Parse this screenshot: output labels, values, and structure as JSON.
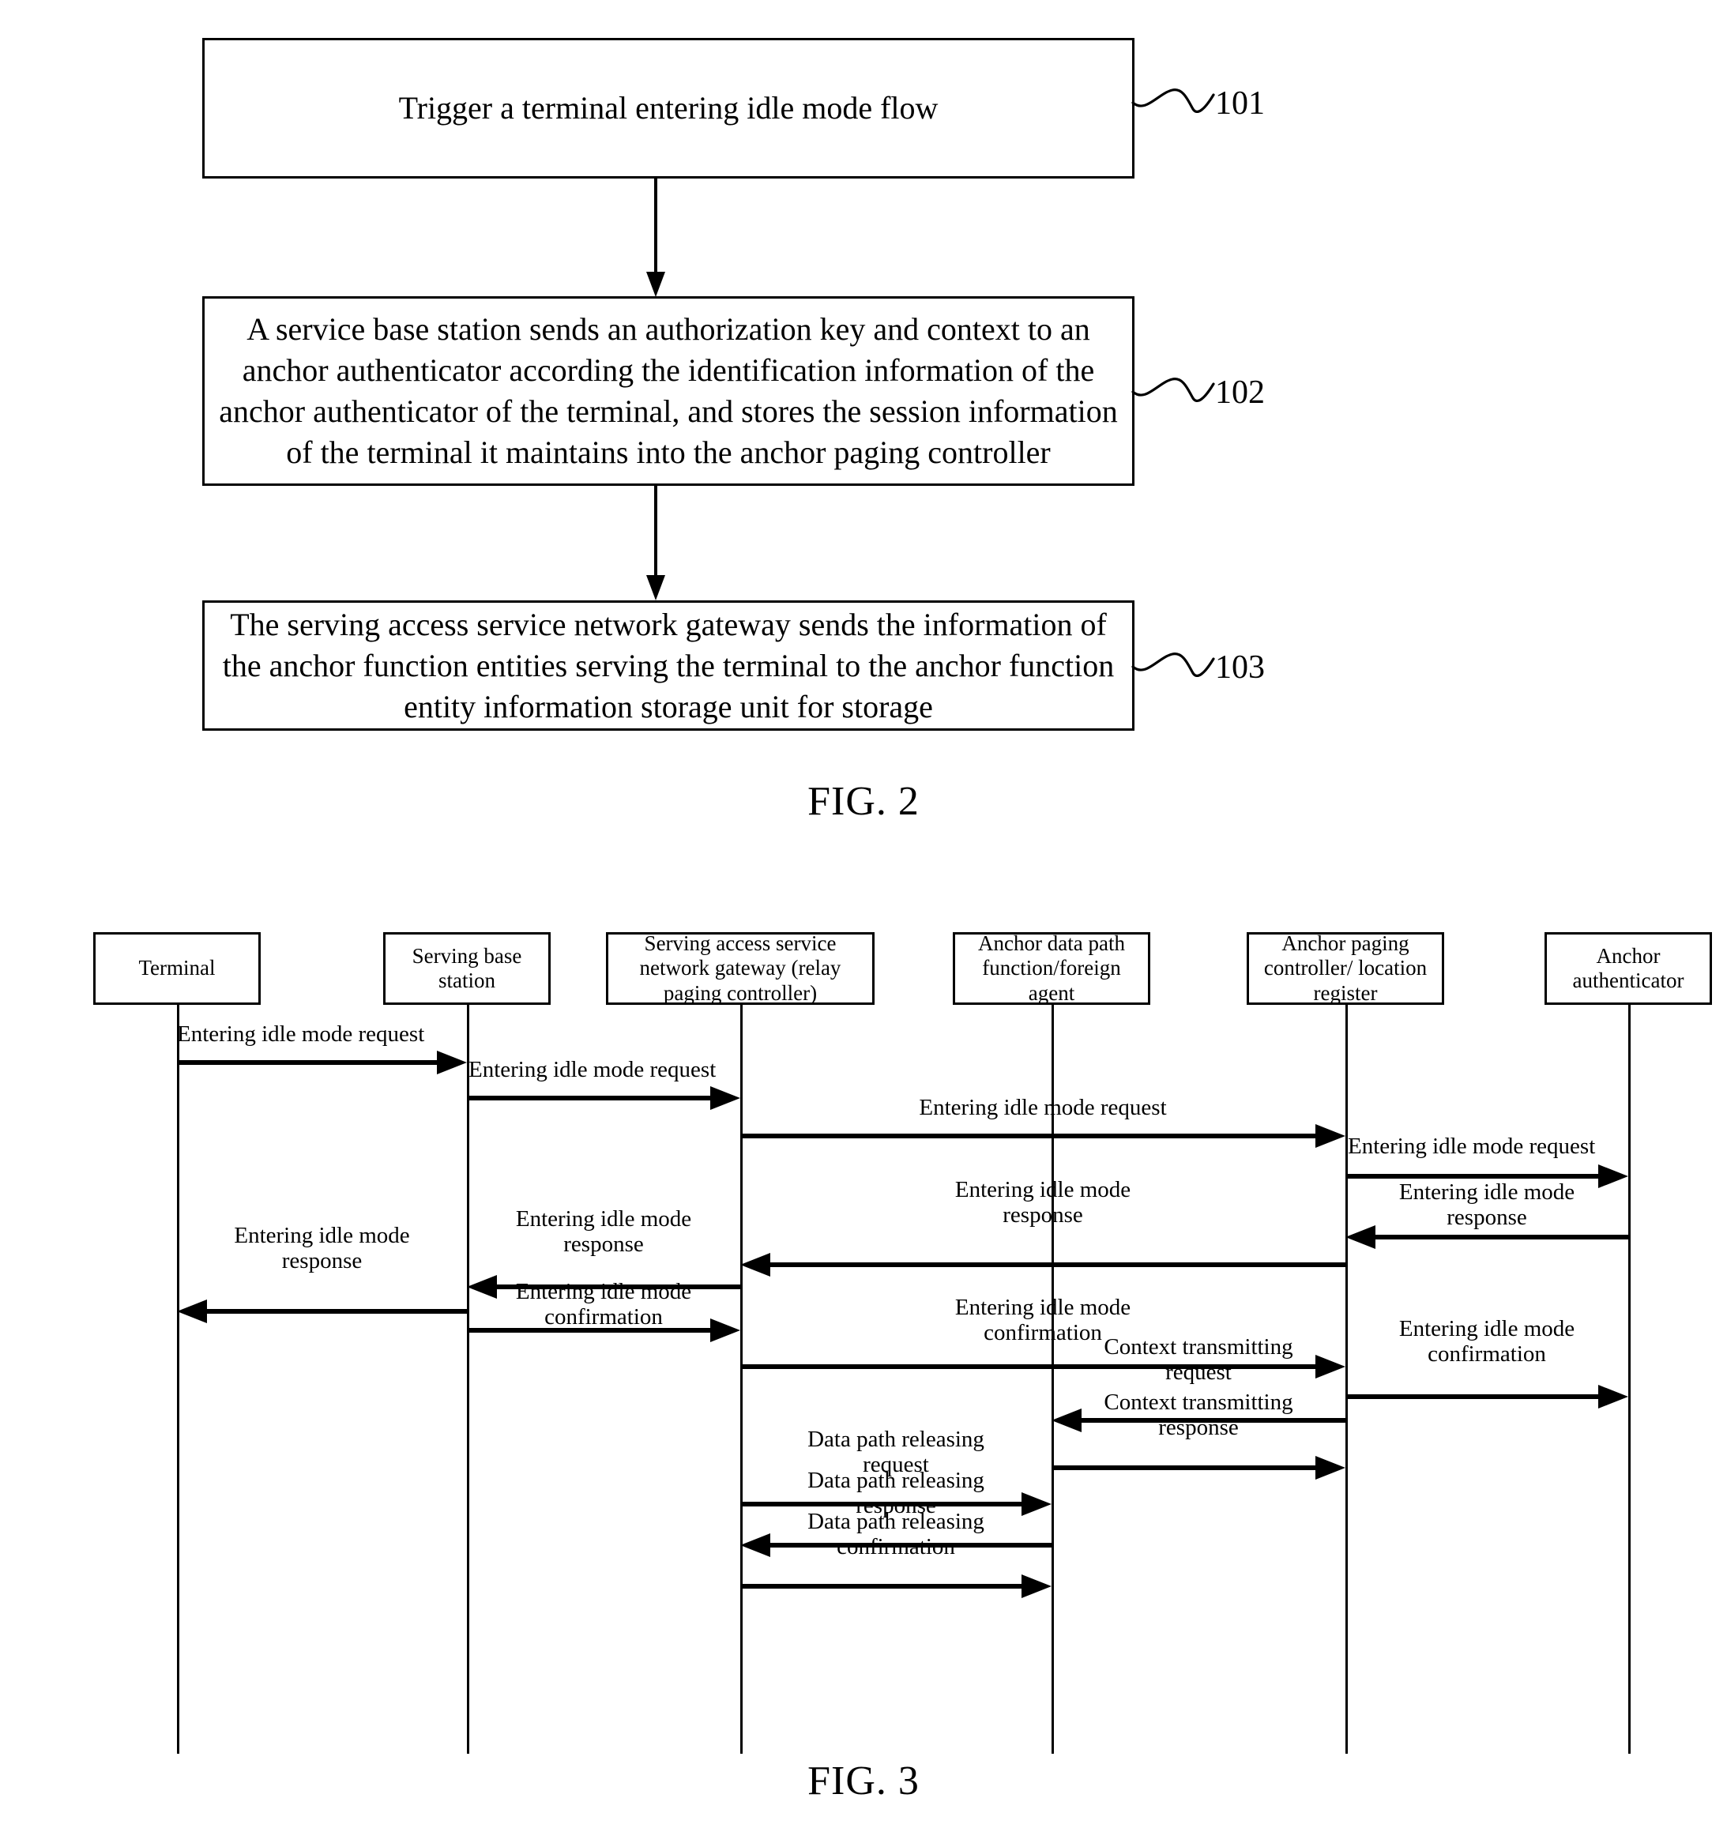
{
  "figure2": {
    "caption": "FIG. 2",
    "steps": [
      {
        "ref": "101",
        "text": "Trigger a terminal entering idle mode flow"
      },
      {
        "ref": "102",
        "text": "A service base station sends an authorization key and context to an anchor authenticator according the identification information of the anchor authenticator of the terminal, and stores the session information of the terminal it maintains into the anchor paging controller"
      },
      {
        "ref": "103",
        "text": "The serving access service network gateway sends the information of the anchor function entities serving the terminal to the anchor function entity information storage unit for storage"
      }
    ]
  },
  "figure3": {
    "caption": "FIG. 3",
    "lifelines": [
      {
        "id": "terminal",
        "label": "Terminal"
      },
      {
        "id": "serving-base-station",
        "label": "Serving base\nstation"
      },
      {
        "id": "serving-asn-gateway",
        "label": "Serving access service\nnetwork gateway (relay\npaging controller)"
      },
      {
        "id": "anchor-data-path-function",
        "label": "Anchor data path\nfunction/foreign\nagent"
      },
      {
        "id": "anchor-paging-controller",
        "label": "Anchor paging\ncontroller/\nlocation register"
      },
      {
        "id": "anchor-authenticator",
        "label": "Anchor\nauthenticator"
      }
    ],
    "messages": [
      {
        "id": "m01",
        "label": "Entering idle mode request",
        "from": "terminal",
        "to": "serving-base-station",
        "direction": "right"
      },
      {
        "id": "m02",
        "label": "Entering idle mode request",
        "from": "serving-base-station",
        "to": "serving-asn-gateway",
        "direction": "right"
      },
      {
        "id": "m03",
        "label": "Entering idle mode request",
        "from": "serving-asn-gateway",
        "to": "anchor-paging-controller",
        "direction": "right"
      },
      {
        "id": "m04",
        "label": "Entering idle mode request",
        "from": "anchor-paging-controller",
        "to": "anchor-authenticator",
        "direction": "right"
      },
      {
        "id": "m05",
        "label": "Entering idle mode\nresponse",
        "from": "anchor-authenticator",
        "to": "anchor-paging-controller",
        "direction": "left"
      },
      {
        "id": "m06",
        "label": "Entering idle mode\nresponse",
        "from": "anchor-paging-controller",
        "to": "serving-asn-gateway",
        "direction": "left"
      },
      {
        "id": "m07",
        "label": "Entering idle mode\nresponse",
        "from": "serving-asn-gateway",
        "to": "serving-base-station",
        "direction": "left"
      },
      {
        "id": "m08",
        "label": "Entering idle mode\nresponse",
        "from": "serving-base-station",
        "to": "terminal",
        "direction": "left"
      },
      {
        "id": "m09",
        "label": "Entering idle mode\nconfirmation",
        "from": "serving-base-station",
        "to": "serving-asn-gateway",
        "direction": "right"
      },
      {
        "id": "m10",
        "label": "Entering idle mode\nconfirmation",
        "from": "serving-asn-gateway",
        "to": "anchor-paging-controller",
        "direction": "right"
      },
      {
        "id": "m11",
        "label": "Entering idle mode\nconfirmation",
        "from": "anchor-paging-controller",
        "to": "anchor-authenticator",
        "direction": "right"
      },
      {
        "id": "m12",
        "label": "Context transmitting\nrequest",
        "from": "anchor-paging-controller",
        "to": "anchor-data-path-function",
        "direction": "left"
      },
      {
        "id": "m13",
        "label": "Context transmitting\nresponse",
        "from": "anchor-data-path-function",
        "to": "anchor-paging-controller",
        "direction": "right"
      },
      {
        "id": "m14",
        "label": "Data path releasing\nrequest",
        "from": "serving-asn-gateway",
        "to": "anchor-data-path-function",
        "direction": "right"
      },
      {
        "id": "m15",
        "label": "Data path releasing\nresponse",
        "from": "anchor-data-path-function",
        "to": "serving-asn-gateway",
        "direction": "left"
      },
      {
        "id": "m16",
        "label": "Data path releasing\nconfirmation",
        "from": "serving-asn-gateway",
        "to": "anchor-data-path-function",
        "direction": "right"
      }
    ]
  }
}
